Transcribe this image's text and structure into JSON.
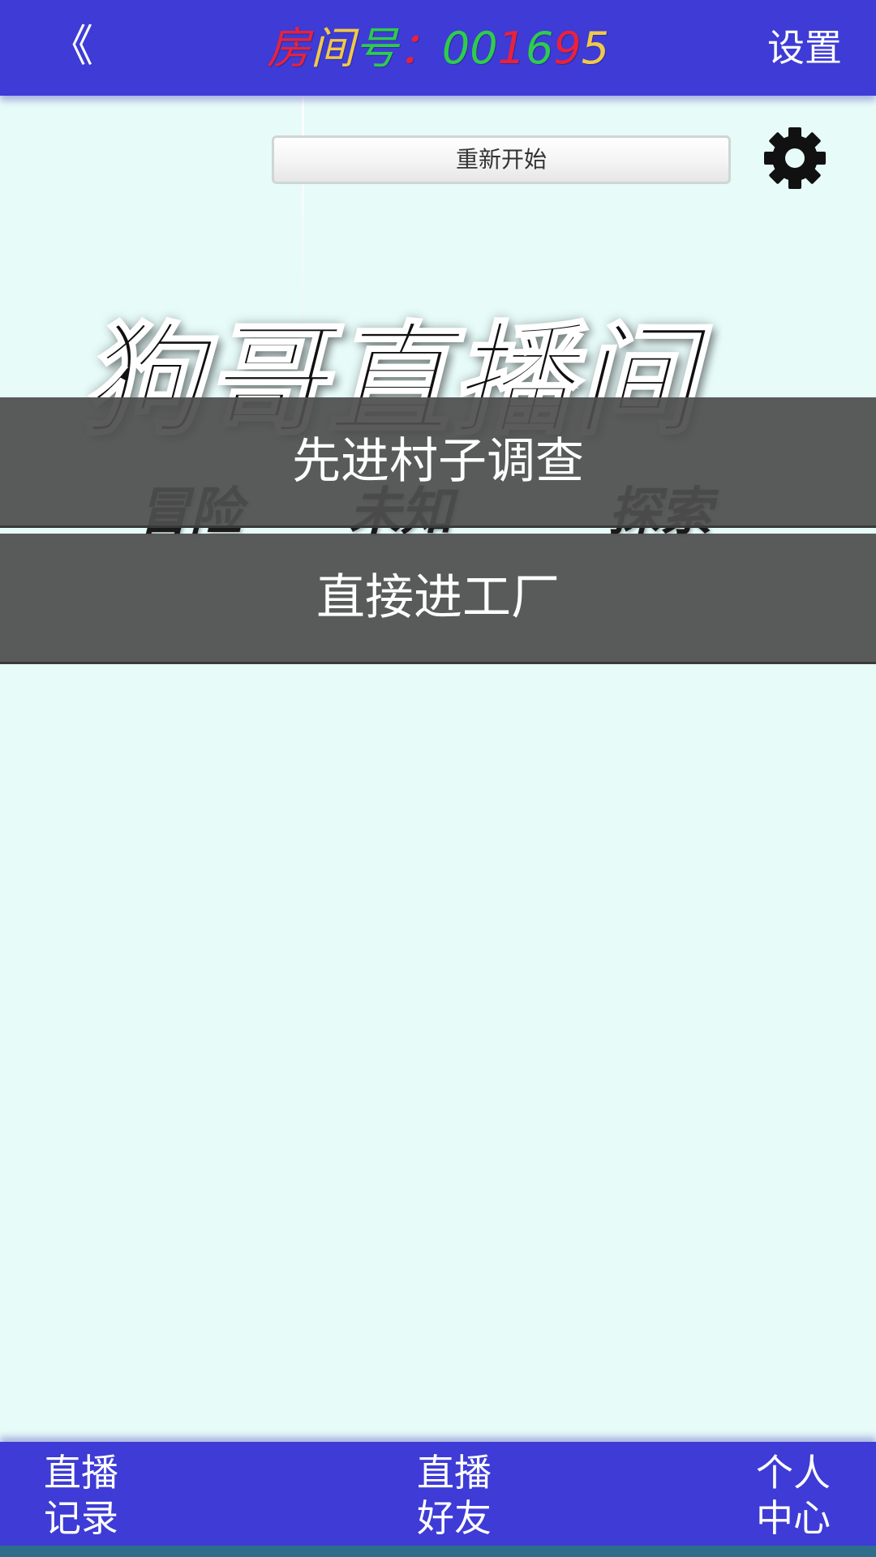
{
  "header": {
    "back_label": "《",
    "room_title_chars": [
      {
        "ch": "房",
        "color": "#e8223c"
      },
      {
        "ch": "间",
        "color": "#f0c84a"
      },
      {
        "ch": "号",
        "color": "#2ecc4c"
      },
      {
        "ch": "：",
        "color": "#e8223c"
      },
      {
        "ch": "0",
        "color": "#2ecc4c"
      },
      {
        "ch": "0",
        "color": "#2ecc4c"
      },
      {
        "ch": "1",
        "color": "#e8223c"
      },
      {
        "ch": "6",
        "color": "#2ecc4c"
      },
      {
        "ch": "9",
        "color": "#e8223c"
      },
      {
        "ch": "5",
        "color": "#f0c84a"
      }
    ],
    "settings_label": "设置"
  },
  "toolbar": {
    "restart_label": "重新开始",
    "gear_icon": "gear-icon"
  },
  "logo": {
    "title": "狗哥直播间",
    "subtitles": [
      "冒险",
      "未知",
      "探索"
    ]
  },
  "choices": [
    {
      "label": "先进村子调查"
    },
    {
      "label": "直接进工厂"
    }
  ],
  "bottom_nav": [
    {
      "line1": "直播",
      "line2": "记录"
    },
    {
      "line1": "直播",
      "line2": "好友"
    },
    {
      "line1": "个人",
      "line2": "中心"
    }
  ],
  "colors": {
    "bar_bg": "#3e3bd6",
    "page_bg": "#e7fbf9",
    "choice_bg": "#4e4f4e"
  }
}
